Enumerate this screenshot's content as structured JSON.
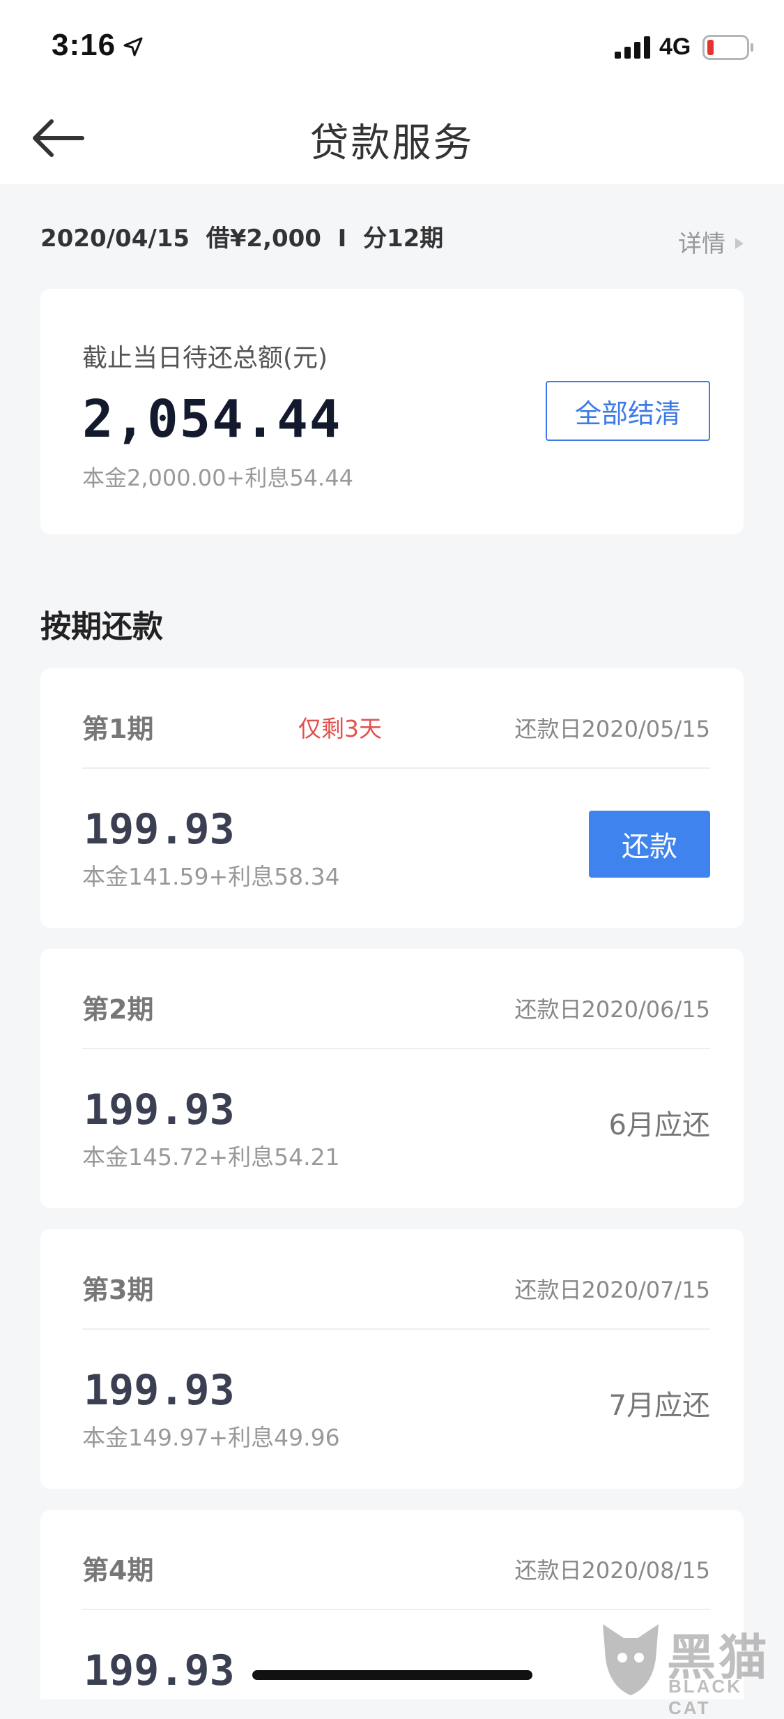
{
  "status_bar": {
    "time": "3:16",
    "network": "4G"
  },
  "nav": {
    "title": "贷款服务"
  },
  "loan_summary": {
    "text": "2020/04/15  借¥2,000  I  分12期",
    "detail_label": "详情"
  },
  "summary_card": {
    "label": "截止当日待还总额(元)",
    "amount": "2,054.44",
    "breakdown": "本金2,000.00+利息54.44",
    "settle_label": "全部结清"
  },
  "section": {
    "heading": "按期还款"
  },
  "periods": [
    {
      "label": "第1期",
      "remaining": "仅剩3天",
      "due": "还款日2020/05/15",
      "amount": "199.93",
      "breakdown": "本金141.59+利息58.34",
      "action_label": "还款"
    },
    {
      "label": "第2期",
      "due": "还款日2020/06/15",
      "amount": "199.93",
      "breakdown": "本金145.72+利息54.21",
      "month_label": "6月应还"
    },
    {
      "label": "第3期",
      "due": "还款日2020/07/15",
      "amount": "199.93",
      "breakdown": "本金149.97+利息49.96",
      "month_label": "7月应还"
    },
    {
      "label": "第4期",
      "due": "还款日2020/08/15",
      "amount": "199.93"
    }
  ],
  "watermark": {
    "cn": "黑猫",
    "en": "BLACK CAT"
  },
  "colors": {
    "accent": "#3F84EE",
    "warning": "#E2514C",
    "background": "#F5F6F8"
  }
}
